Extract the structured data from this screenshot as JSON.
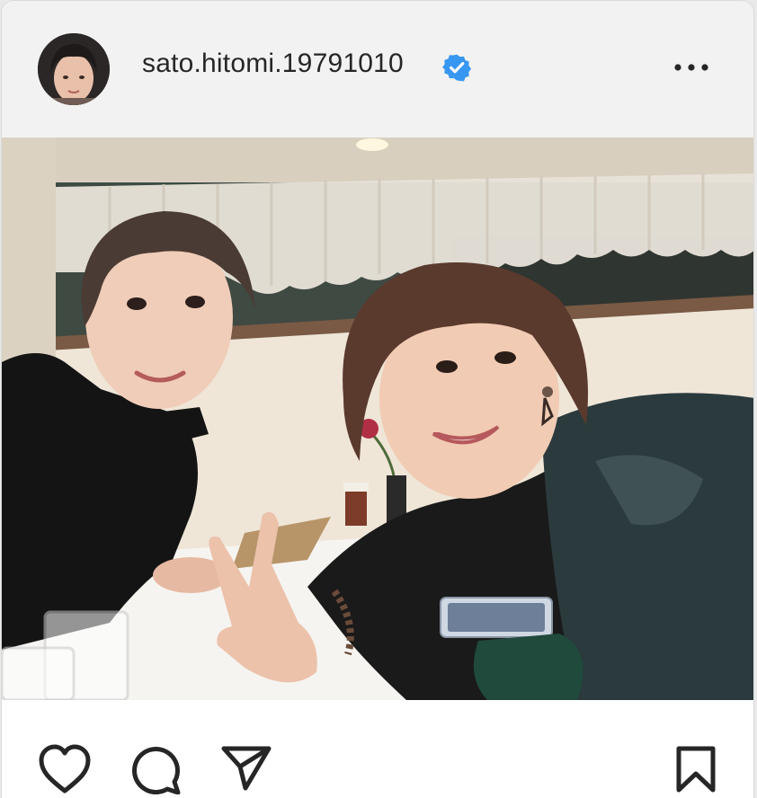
{
  "post": {
    "username": "sato.hitomi.19791010",
    "verified": true,
    "accent_verified": "#3897f0"
  },
  "header": {
    "avatar_icon": "profile-avatar",
    "more_icon": "more-options-icon"
  },
  "photo": {
    "alt_description": "selfie-photo"
  },
  "actions": {
    "like_icon": "heart-icon",
    "comment_icon": "comment-icon",
    "share_icon": "paper-plane-icon",
    "save_icon": "bookmark-icon"
  }
}
